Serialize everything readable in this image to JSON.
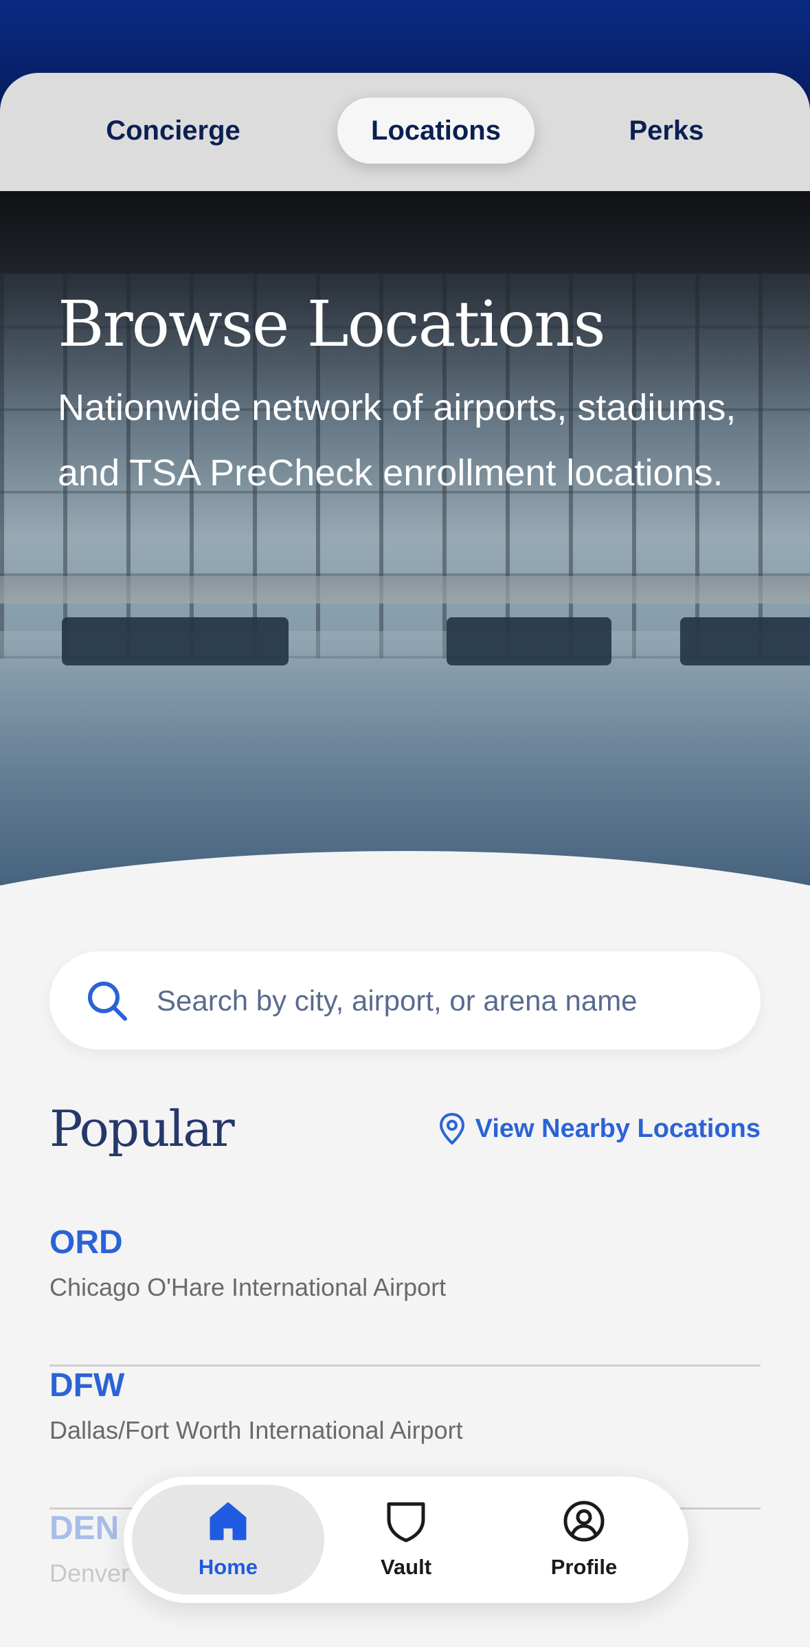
{
  "colors": {
    "brand_navy": "#0b1f52",
    "accent_blue": "#2b63d6",
    "background": "#f4f4f4"
  },
  "tabs": [
    {
      "label": "Concierge",
      "active": false
    },
    {
      "label": "Locations",
      "active": true
    },
    {
      "label": "Perks",
      "active": false
    }
  ],
  "hero": {
    "title": "Browse Locations",
    "subtitle": "Nationwide network of airports, stadiums, and TSA PreCheck enrollment locations."
  },
  "search": {
    "icon": "search-icon",
    "placeholder": "Search by city, airport, or arena name",
    "value": ""
  },
  "popular": {
    "heading": "Popular",
    "nearby_link": {
      "label": "View Nearby Locations",
      "icon": "location-pin-icon"
    },
    "items": [
      {
        "code": "ORD",
        "name": "Chicago O'Hare International Airport"
      },
      {
        "code": "DFW",
        "name": "Dallas/Fort Worth International Airport"
      },
      {
        "code": "DEN",
        "name": "Denver"
      }
    ]
  },
  "bottom_nav": {
    "items": [
      {
        "label": "Home",
        "icon": "home-icon",
        "active": true
      },
      {
        "label": "Vault",
        "icon": "shield-icon",
        "active": false
      },
      {
        "label": "Profile",
        "icon": "profile-icon",
        "active": false
      }
    ]
  }
}
